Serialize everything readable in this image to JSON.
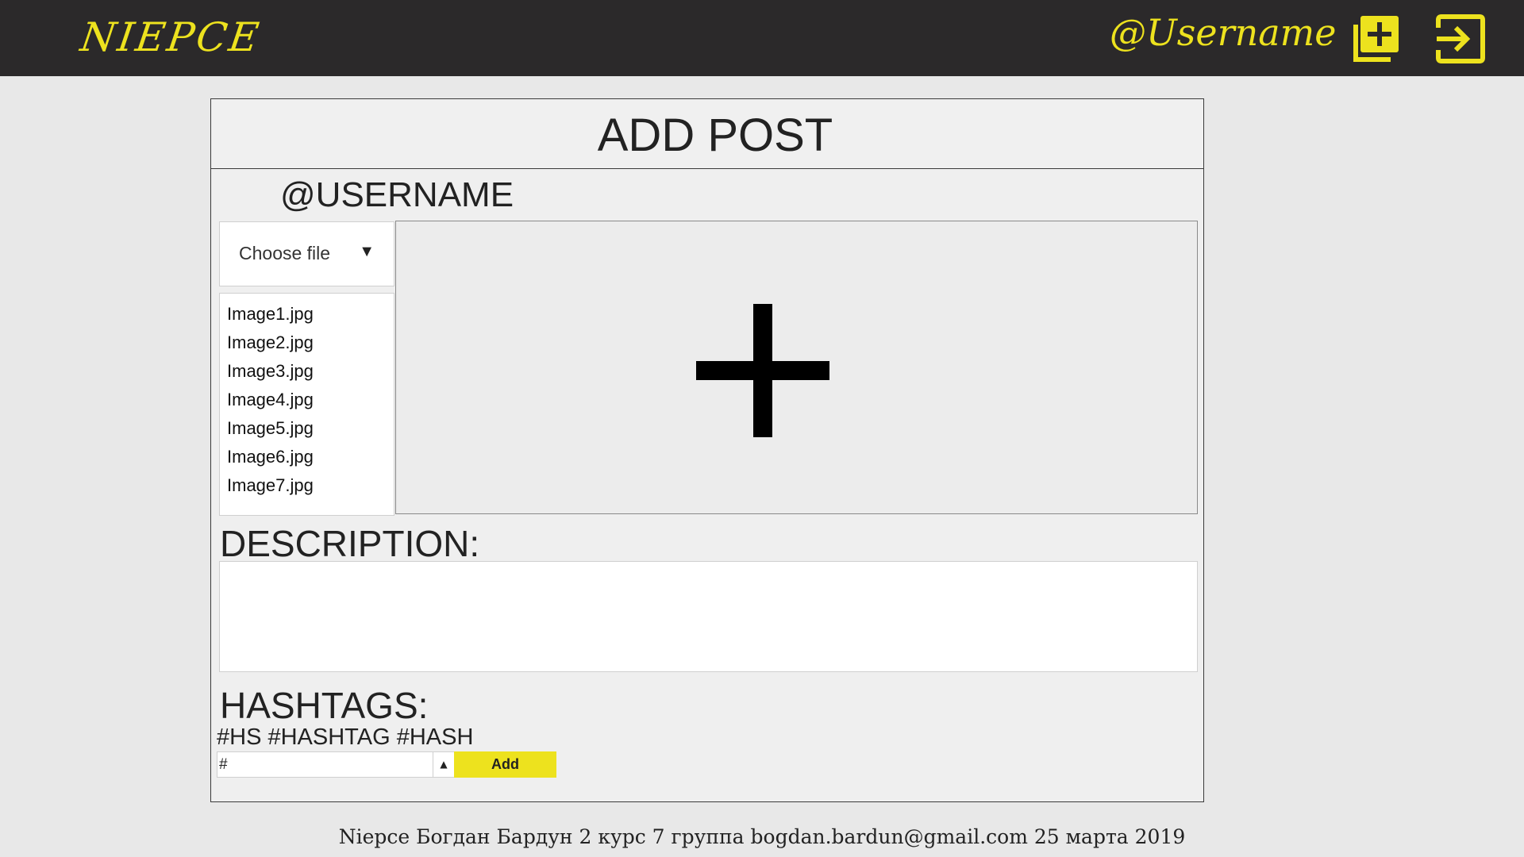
{
  "header": {
    "logo": "NIEPCE",
    "username": "@Username",
    "add_post_icon": "add-box-icon",
    "logout_icon": "logout-icon"
  },
  "panel": {
    "title": "ADD POST",
    "post_username": "@USERNAME",
    "file_select": {
      "label": "Choose file",
      "arrow": "▼"
    },
    "files": [
      "Image1.jpg",
      "Image2.jpg",
      "Image3.jpg",
      "Image4.jpg",
      "Image5.jpg",
      "Image6.jpg",
      "Image7.jpg"
    ],
    "dropzone_icon": "plus-icon",
    "description_label": "DESCRIPTION:",
    "description_value": "",
    "hashtags_label": "HASHTAGS:",
    "hashtags": "#HS #HASHTAG #HASH",
    "hashtag_input_value": "#",
    "add_button": "Add"
  },
  "footer": {
    "text": "Niepce Богдан Бардун 2 курс 7 группа  bogdan.bardun@gmail.com 25 марта 2019"
  },
  "colors": {
    "accent": "#ede21e",
    "topbar": "#2b292a",
    "background": "#e8e8e8"
  }
}
